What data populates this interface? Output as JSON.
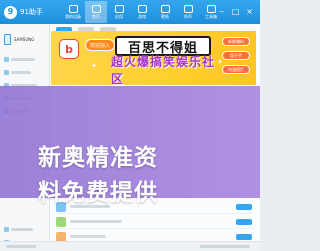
{
  "app": {
    "brand_name": "91助手",
    "logo_glyph": "9"
  },
  "nav": {
    "items": [
      {
        "label": "我的设备",
        "active": false
      },
      {
        "label": "首页",
        "active": true
      },
      {
        "label": "应用",
        "active": false
      },
      {
        "label": "游戏",
        "active": false
      },
      {
        "label": "壁纸",
        "active": false
      },
      {
        "label": "铃声",
        "active": false
      },
      {
        "label": "工具箱",
        "active": false
      }
    ],
    "window_controls": [
      "‒",
      "□",
      "×"
    ]
  },
  "device": {
    "name": "SAMSUNG"
  },
  "banner": {
    "logo_glyph": "b",
    "pill_left": "欢迎加入",
    "title": "百思不得姐",
    "subtitle": "超火爆搞笑娱乐社区",
    "pills_right": [
      "新鲜爆料",
      "段子手",
      "内涵图片"
    ]
  },
  "watermark": {
    "line1": "新奥精准资",
    "line2": "料免费提供"
  },
  "colors": {
    "topbar": "#1f8fdc",
    "accent": "#35a5ee",
    "banner_bg": "#ffd54a",
    "banner_title_border": "#1a1a1a",
    "banner_subtitle": "#a832c9",
    "overlay": "#8c6ed2"
  }
}
